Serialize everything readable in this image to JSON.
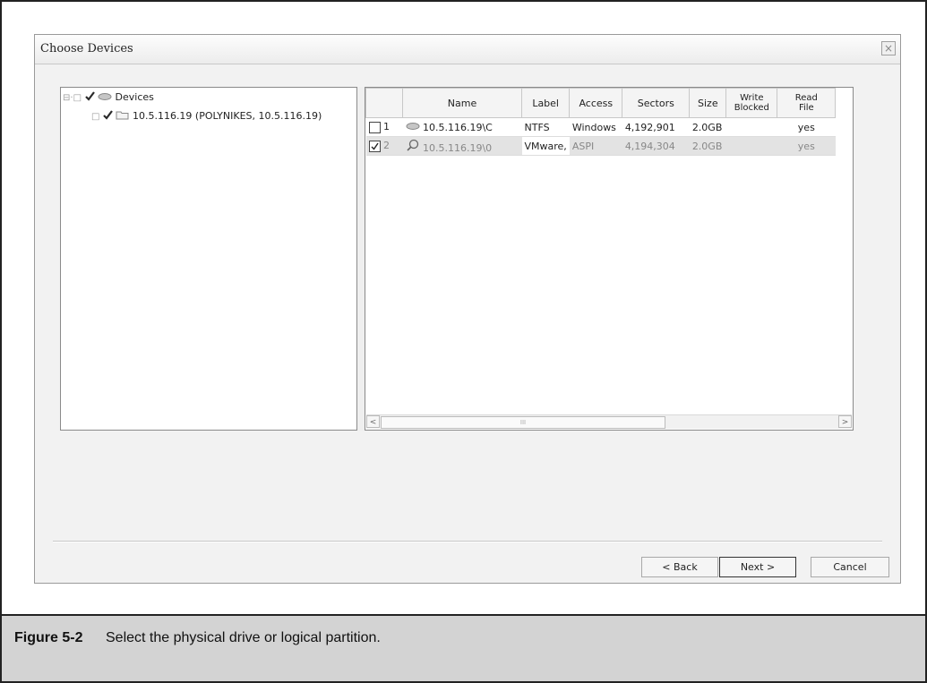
{
  "dialog": {
    "title": "Choose Devices",
    "close_glyph": "×"
  },
  "tree": {
    "root": {
      "label": "Devices",
      "checked": true,
      "icon": "drive-icon"
    },
    "children": [
      {
        "label": "10.5.116.19 (POLYNIKES, 10.5.116.19)",
        "checked": true,
        "icon": "folder-icon"
      }
    ]
  },
  "grid": {
    "columns": [
      "Name",
      "Label",
      "Access",
      "Sectors",
      "Size",
      "Write Blocked",
      "Read File"
    ],
    "column_lines": {
      "write_blocked": [
        "Write",
        "Blocked"
      ],
      "read_file": [
        "Read",
        "File"
      ]
    },
    "rows": [
      {
        "index": "1",
        "checked": false,
        "icon": "drive-icon",
        "name": "10.5.116.19\\C",
        "label": "NTFS",
        "access": "Windows",
        "sectors": "4,192,901",
        "size": "2.0GB",
        "write_blocked": "",
        "read_file": "yes"
      },
      {
        "index": "2",
        "checked": true,
        "icon": "magnifier-icon",
        "name": "10.5.116.19\\0",
        "label": "VMware,",
        "access": "ASPI",
        "sectors": "4,194,304",
        "size": "2.0GB",
        "write_blocked": "",
        "read_file": "yes"
      }
    ],
    "scroll_left": "<",
    "scroll_right": ">",
    "thumb_grip": "III"
  },
  "buttons": {
    "back": "< Back",
    "next": "Next >",
    "cancel": "Cancel"
  },
  "caption": {
    "number": "Figure 5-2",
    "text": "Select the physical drive or logical partition."
  }
}
